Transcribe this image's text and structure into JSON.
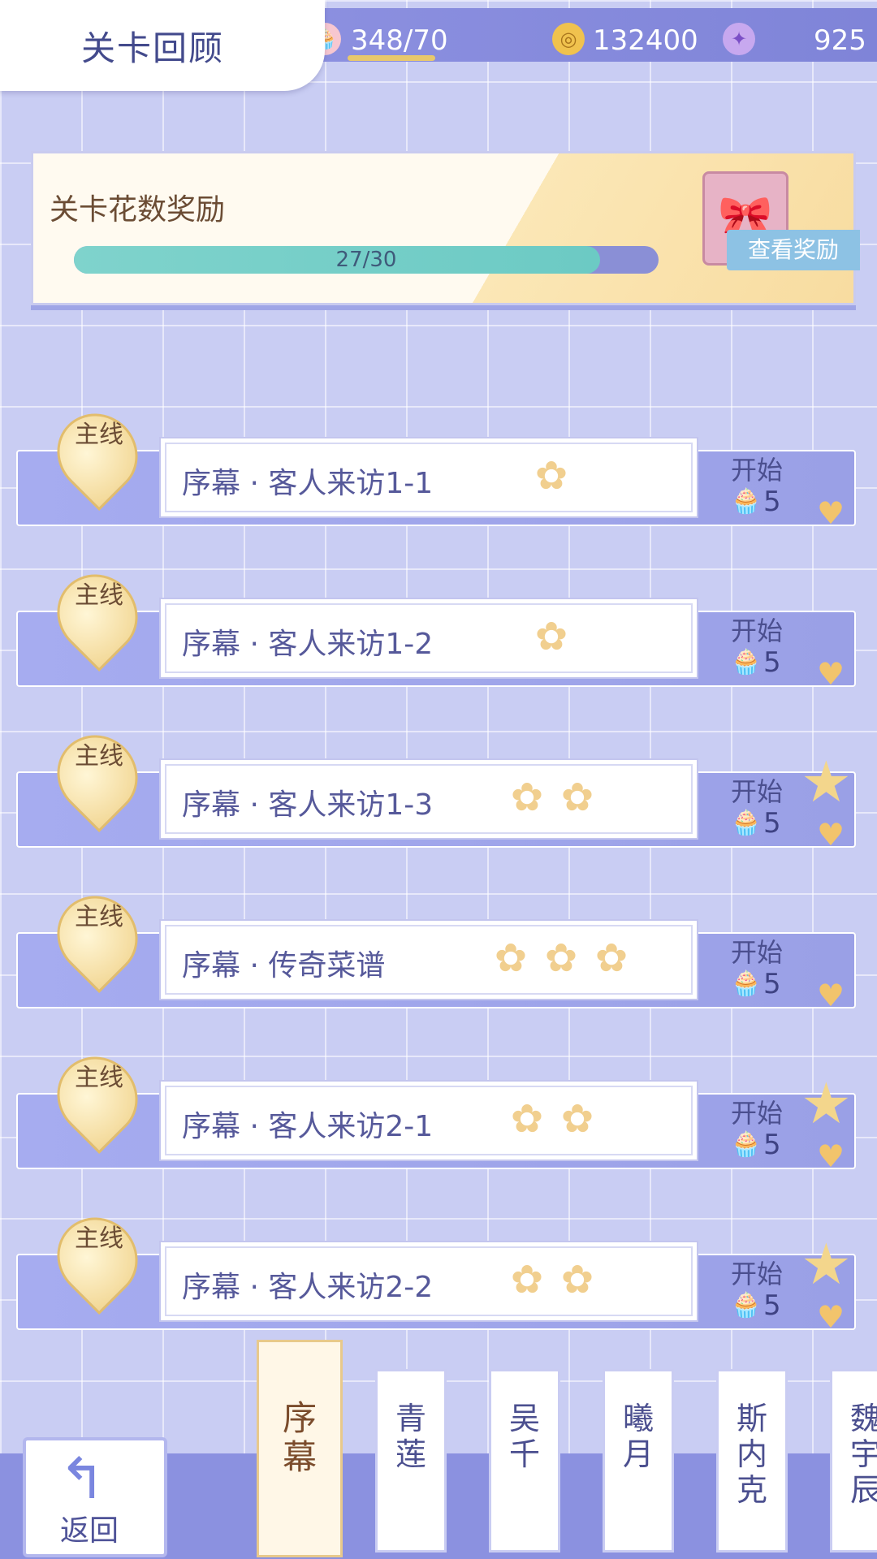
{
  "header": {
    "title": "关卡回顾",
    "resources": [
      {
        "icon": "cupcake-icon",
        "value": "348/70"
      },
      {
        "icon": "gold-coin-icon",
        "value": "132400"
      },
      {
        "icon": "swan-gem-icon",
        "value": "925"
      }
    ]
  },
  "reward": {
    "title": "关卡花数奖励",
    "progress_text": "27/30",
    "progress_fraction": 0.9,
    "view_button": "查看奖励"
  },
  "levels": [
    {
      "tag": "主线",
      "name": "序幕 · 客人来访1-1",
      "flowers": 1,
      "starred": false,
      "start": "开始",
      "cost": "5"
    },
    {
      "tag": "主线",
      "name": "序幕 · 客人来访1-2",
      "flowers": 1,
      "starred": false,
      "start": "开始",
      "cost": "5"
    },
    {
      "tag": "主线",
      "name": "序幕 · 客人来访1-3",
      "flowers": 2,
      "starred": true,
      "start": "开始",
      "cost": "5"
    },
    {
      "tag": "主线",
      "name": "序幕 · 传奇菜谱",
      "flowers": 3,
      "starred": false,
      "start": "开始",
      "cost": "5"
    },
    {
      "tag": "主线",
      "name": "序幕 · 客人来访2-1",
      "flowers": 2,
      "starred": true,
      "start": "开始",
      "cost": "5"
    },
    {
      "tag": "主线",
      "name": "序幕 · 客人来访2-2",
      "flowers": 2,
      "starred": true,
      "start": "开始",
      "cost": "5"
    }
  ],
  "chapters": [
    {
      "label": "序\n幕",
      "active": true
    },
    {
      "label": "青\n莲",
      "active": false
    },
    {
      "label": "吴\n千",
      "active": false
    },
    {
      "label": "曦\n月",
      "active": false
    },
    {
      "label": "斯\n内\n克",
      "active": false
    },
    {
      "label": "魏\n宇\n辰",
      "active": false
    }
  ],
  "back": {
    "label": "返回"
  }
}
